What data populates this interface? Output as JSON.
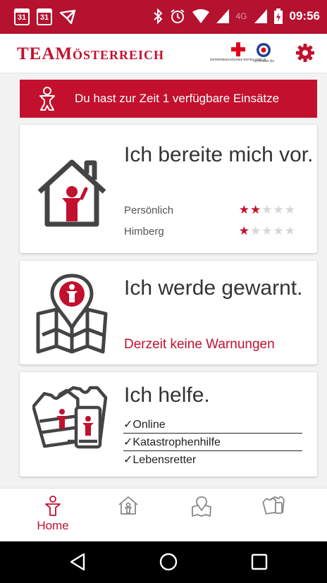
{
  "status_bar": {
    "calendar_icon_1": "31",
    "calendar_icon_2": "31",
    "network_label": "4G",
    "time": "09:56",
    "icons": [
      "calendar-icon",
      "calendar-icon",
      "mail-icon",
      "bluetooth-icon",
      "alarm-icon",
      "wifi-icon",
      "signal-icon",
      "battery-icon"
    ]
  },
  "header": {
    "logo_team": "TEAM",
    "logo_country": "ÖSTERREICH",
    "partner_red_cross": "ÖSTERREICHISCHES ROTES KREUZ",
    "partner_radio": "HITRADIO Ö3",
    "settings_icon": "gear-icon"
  },
  "banner": {
    "text": "Du hast zur Zeit 1 verfügbare Einsätze",
    "icon": "volunteer-icon"
  },
  "cards": {
    "prepare": {
      "title": "Ich bereite mich vor.",
      "ratings": [
        {
          "label": "Persönlich",
          "stars": 2,
          "max": 5
        },
        {
          "label": "Himberg",
          "stars": 1,
          "max": 5
        }
      ]
    },
    "warned": {
      "title": "Ich werde gewarnt.",
      "status": "Derzeit keine Warnungen"
    },
    "help": {
      "title": "Ich helfe.",
      "items": [
        "✓Online",
        "✓Katastrophenhilfe",
        "✓Lebensretter"
      ]
    }
  },
  "bottom_nav": {
    "items": [
      {
        "label": "Home",
        "icon": "home-person-icon",
        "active": true
      },
      {
        "label": "",
        "icon": "house-icon",
        "active": false
      },
      {
        "label": "",
        "icon": "map-pin-icon",
        "active": false
      },
      {
        "label": "",
        "icon": "vests-icon",
        "active": false
      }
    ]
  },
  "colors": {
    "brand_red": "#c3102e",
    "status_bar": "#b4122f",
    "star_off": "#d6d6d6"
  }
}
